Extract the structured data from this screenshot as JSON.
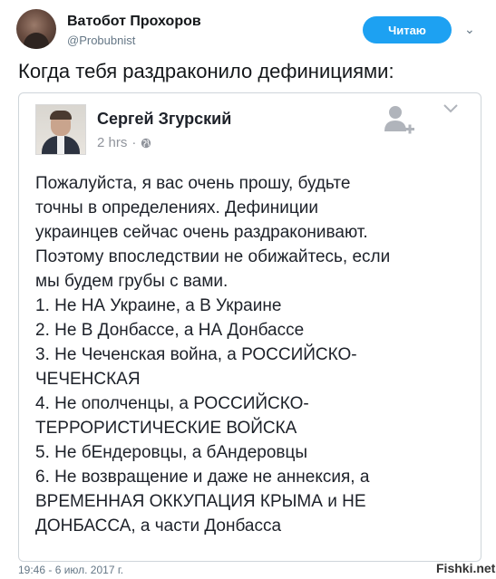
{
  "tweet": {
    "author_name": "Ватобот Прохоров",
    "author_handle": "@Probubnist",
    "follow_label": "Читаю",
    "text": "Когда тебя раздраконило дефинициями:",
    "timestamp": "19:46 - 6 июл. 2017 г."
  },
  "fb_post": {
    "author_name": "Сергей Згурский",
    "time": "2 hrs",
    "separator": "·",
    "lines": [
      "Пожалуйста, я вас очень прошу, будьте",
      "точны в определениях. Дефиниции",
      "украинцев сейчас очень раздраконивают.",
      "Поэтому впоследствии не обижайтесь, если",
      "мы будем грубы с вами.",
      "1. Не НА Украине, а В Украине",
      "2. Не В Донбассе, а НА Донбассе",
      "3. Не Чеченская война, а РОССИЙСКО-",
      "ЧЕЧЕНСКАЯ",
      "4. Не ополченцы, а РОССИЙСКО-",
      "ТЕРРОРИСТИЧЕСКИЕ ВОЙСКА",
      "5. Не бЕндеровцы, а бАндеровцы",
      "6. Не возвращение и даже не аннексия, а",
      "ВРЕМЕННАЯ ОККУПАЦИЯ КРЫМА и НЕ",
      "ДОНБАССА, а части Донбасса"
    ]
  },
  "watermark": "Fishki.net",
  "icons": {
    "follow_caret": "chevron-down-icon",
    "globe": "globe-icon",
    "add_friend": "add-friend-icon",
    "post_menu": "chevron-down-icon"
  },
  "colors": {
    "accent": "#1da1f2",
    "text": "#14171a",
    "muted": "#657786",
    "fb_muted": "#90949c",
    "card_border": "#cfd5da"
  }
}
